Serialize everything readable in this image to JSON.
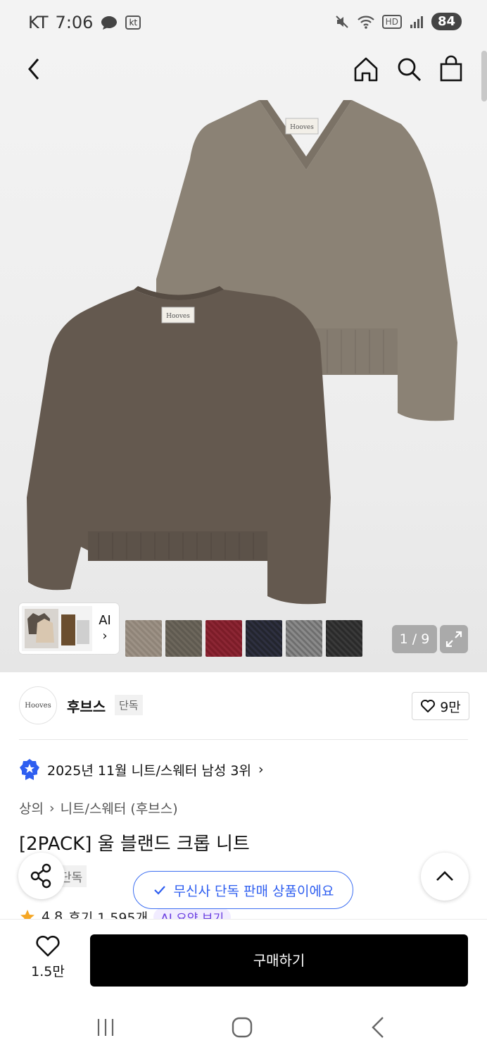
{
  "status_bar": {
    "carrier": "KT",
    "time": "7:06",
    "carrier_badge": "kt",
    "hd_badge": "HD",
    "battery": "84",
    "icons": [
      "chat-bubble-icon",
      "mute-icon",
      "wifi-icon",
      "signal-icon"
    ]
  },
  "nav": {
    "icons": [
      "back-icon",
      "home-icon",
      "search-icon",
      "shopping-bag-icon"
    ]
  },
  "gallery": {
    "ai_label": "AI",
    "ai_chevron": "›",
    "pager": "1 / 9",
    "swatch_colors": [
      "#8f8478",
      "#5f5a50",
      "#7c1c28",
      "#23252e",
      "#8a8a8a",
      "#2a2a2a"
    ],
    "product_colors": {
      "vneck": "#8b8275",
      "crewneck": "#64594f"
    },
    "label_text": "Hooves"
  },
  "brand": {
    "logo_text": "Hooves",
    "name": "후브스",
    "tag": "단독",
    "likes": "9만"
  },
  "ranking": {
    "text": "2025년 11월 니트/스웨터 남성 3위",
    "chevron": "›"
  },
  "breadcrumb": {
    "first": "상의",
    "sep": "›",
    "second": "니트/스웨터 (후브스)"
  },
  "product": {
    "title": "[2PACK] 울 블랜드 크롭 니트",
    "sub_tag": "단독",
    "rating": "4.8",
    "reviews": "후기 1,595개",
    "ai_summary": "AI 요약 보기"
  },
  "toast": {
    "text": "무신사 단독 판매 상품이에요"
  },
  "bottom": {
    "wish_count": "1.5만",
    "buy_label": "구매하기"
  },
  "colors": {
    "accent_blue": "#2e5ef0",
    "buy_button": "#000000",
    "ai_purple": "#6a3de0",
    "star": "#f5a623"
  }
}
